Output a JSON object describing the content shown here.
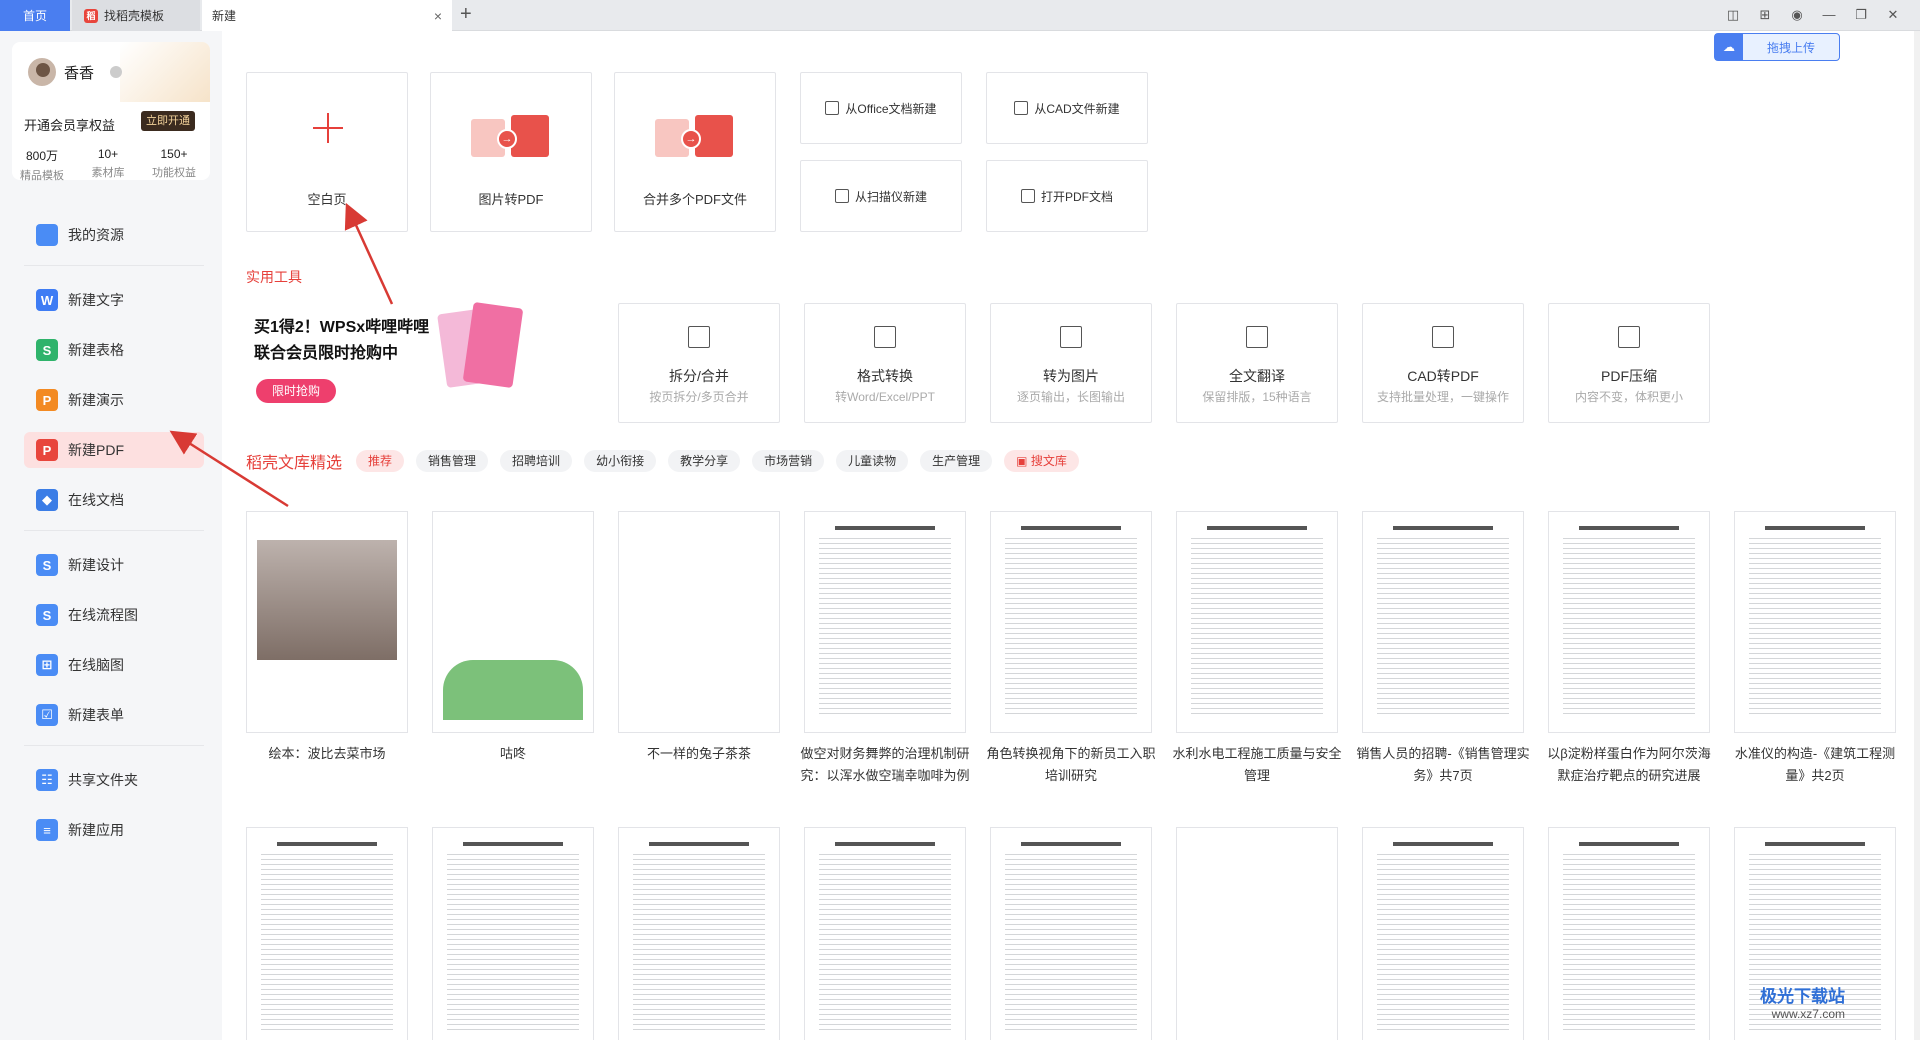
{
  "tabs": {
    "home": "首页",
    "template": "找稻壳模板",
    "new": "新建",
    "close": "×",
    "add": "+"
  },
  "user": {
    "name": "香香",
    "member_text": "开通会员享权益",
    "open_button": "立即开通",
    "stats": [
      {
        "value": "800万",
        "label": "精品模板"
      },
      {
        "value": "10+",
        "label": "素材库"
      },
      {
        "value": "150+",
        "label": "功能权益"
      }
    ]
  },
  "sidebar": {
    "items": [
      {
        "label": "我的资源",
        "icon": "folder-icon",
        "color": "#4a8cf5"
      },
      {
        "label": "新建文字",
        "icon": "word-icon",
        "color": "#3e7cf4",
        "glyph": "W"
      },
      {
        "label": "新建表格",
        "icon": "sheet-icon",
        "color": "#2fb36b",
        "glyph": "S"
      },
      {
        "label": "新建演示",
        "icon": "slides-icon",
        "color": "#f38a22",
        "glyph": "P"
      },
      {
        "label": "新建PDF",
        "icon": "pdf-icon",
        "color": "#e8453c",
        "glyph": "P"
      },
      {
        "label": "在线文档",
        "icon": "online-doc-icon",
        "color": "#3b7de6",
        "glyph": "◆"
      },
      {
        "label": "新建设计",
        "icon": "design-icon",
        "color": "#4a8cf5",
        "glyph": "S"
      },
      {
        "label": "在线流程图",
        "icon": "flowchart-icon",
        "color": "#4a8cf5",
        "glyph": "S"
      },
      {
        "label": "在线脑图",
        "icon": "mindmap-icon",
        "color": "#4a8cf5",
        "glyph": "⊞"
      },
      {
        "label": "新建表单",
        "icon": "form-icon",
        "color": "#4a8cf5",
        "glyph": "☑"
      },
      {
        "label": "共享文件夹",
        "icon": "shared-folder-icon",
        "color": "#4a8cf5",
        "glyph": "☷"
      },
      {
        "label": "新建应用",
        "icon": "app-icon",
        "color": "#4a8cf5",
        "glyph": "≡"
      }
    ]
  },
  "create": {
    "blank": "空白页",
    "image_to_pdf": "图片转PDF",
    "merge_pdf": "合并多个PDF文件",
    "from_office": "从Office文档新建",
    "from_cad": "从CAD文件新建",
    "from_scanner": "从扫描仪新建",
    "open_pdf": "打开PDF文档"
  },
  "upload_button": "拖拽上传",
  "tools": {
    "title": "实用工具",
    "items": [
      {
        "name": "拆分/合并",
        "desc": "按页拆分/多页合并",
        "icon": "split-icon"
      },
      {
        "name": "格式转换",
        "desc": "转Word/Excel/PPT",
        "icon": "convert-icon"
      },
      {
        "name": "转为图片",
        "desc": "逐页输出，长图输出",
        "icon": "image-icon"
      },
      {
        "name": "全文翻译",
        "desc": "保留排版，15种语言",
        "icon": "translate-icon"
      },
      {
        "name": "CAD转PDF",
        "desc": "支持批量处理，一键操作",
        "icon": "cad-icon"
      },
      {
        "name": "PDF压缩",
        "desc": "内容不变，体积更小",
        "icon": "compress-icon"
      }
    ]
  },
  "promo": {
    "line1": "买1得2！WPSx哔哩哔哩",
    "line2": "联合会员限时抢购中",
    "button": "限时抢购"
  },
  "library": {
    "title": "稻壳文库精选",
    "chips": [
      "推荐",
      "销售管理",
      "招聘培训",
      "幼小衔接",
      "教学分享",
      "市场营销",
      "儿童读物",
      "生产管理"
    ],
    "search_chip": "搜文库",
    "docs_row1": [
      "绘本：波比去菜市场",
      "咕咚",
      "不一样的兔子茶茶",
      "做空对财务舞弊的治理机制研究：以浑水做空瑞幸咖啡为例",
      "角色转换视角下的新员工入职培训研究",
      "水利水电工程施工质量与安全管理",
      "销售人员的招聘-《销售管理实务》共7页",
      "以β淀粉样蛋白作为阿尔茨海默症治疗靶点的研究进展",
      "水准仪的构造-《建筑工程测量》共2页"
    ],
    "docs_row2_count": 9
  },
  "watermark": {
    "brand": "极光下载站",
    "url": "www.xz7.com"
  }
}
